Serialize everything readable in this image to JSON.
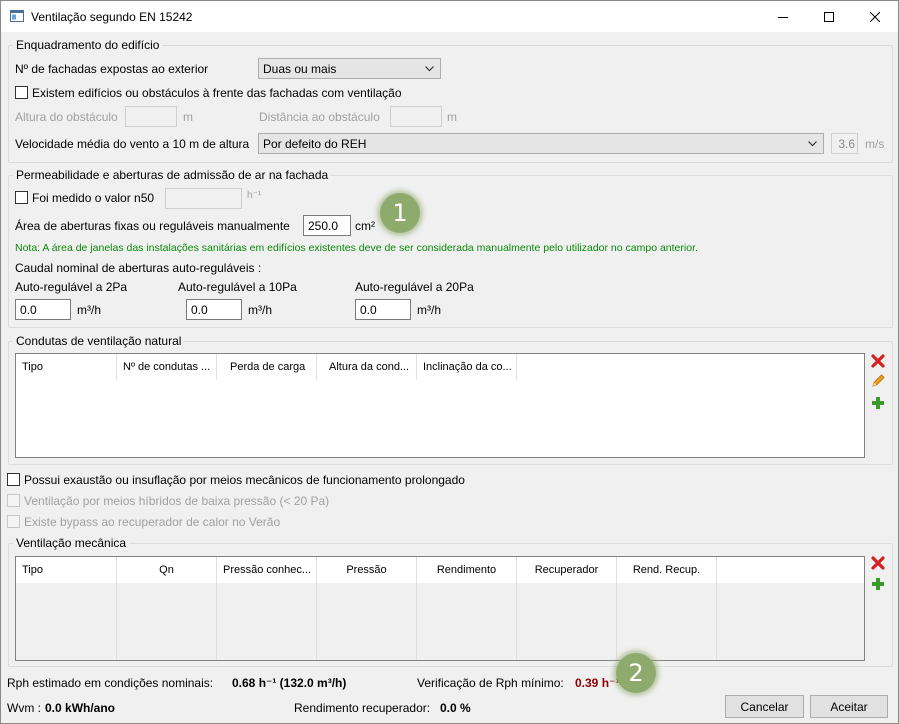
{
  "window": {
    "title": "Ventilação segundo EN 15242"
  },
  "building_group": {
    "title": "Enquadramento do edifício",
    "facades_label": "Nº de fachadas expostas ao exterior",
    "facades_value": "Duas ou mais",
    "obstacles_label": "Existem edifícios ou obstáculos à frente das fachadas com ventilação",
    "obstacle_height_label": "Altura do obstáculo",
    "obstacle_height_unit": "m",
    "obstacle_distance_label": "Distância ao obstáculo",
    "obstacle_distance_unit": "m",
    "wind_label": "Velocidade média do vento a 10 m de altura",
    "wind_value": "Por defeito do REH",
    "wind_speed_value": "3.6",
    "wind_speed_unit": "m/s"
  },
  "permeability_group": {
    "title": "Permeabilidade e aberturas de admissão de ar na fachada",
    "n50_label": "Foi medido o valor n50",
    "n50_unit": "h⁻¹",
    "area_label": "Área de aberturas fixas ou reguláveis manualmente",
    "area_value": "250.0",
    "area_unit": "cm²",
    "badge_1": "1",
    "note": "Nota: A área de janelas das instalações sanitárias em edifícios existentes deve de ser considerada manualmente pelo utilizador no campo anterior.",
    "flow_label": "Caudal nominal de aberturas auto-reguláveis :",
    "auto_2pa_label": "Auto-regulável a 2Pa",
    "auto_2pa_value": "0.0",
    "auto_10pa_label": "Auto-regulável a 10Pa",
    "auto_10pa_value": "0.0",
    "auto_20pa_label": "Auto-regulável a 20Pa",
    "auto_20pa_value": "0.0",
    "flow_unit": "m³/h"
  },
  "natural_ducts_group": {
    "title": "Condutas de ventilação natural",
    "columns": [
      "Tipo",
      "Nº de condutas ...",
      "Perda de carga",
      "Altura da cond...",
      "Inclinação da co..."
    ]
  },
  "mechanical_options": {
    "mech_exhaust_label": "Possui exaustão ou insuflação por meios mecânicos de funcionamento prolongado",
    "hybrid_label": "Ventilação por meios híbridos de baixa pressão (< 20 Pa)",
    "bypass_label": "Existe bypass ao recuperador de calor no Verão"
  },
  "mechanical_group": {
    "title": "Ventilação mecânica",
    "columns": [
      "Tipo",
      "Qn",
      "Pressão conhec...",
      "Pressão",
      "Rendimento",
      "Recuperador",
      "Rend. Recup."
    ]
  },
  "footer": {
    "rph_label": "Rph estimado em condições nominais:",
    "rph_value": "0.68 h⁻¹ (132.0 m³/h)",
    "rph_min_label": "Verificação de Rph mínimo:",
    "rph_min_value": "0.39 h⁻¹",
    "badge_2": "2",
    "wvm_label": "Wvm :",
    "wvm_value": "0.0 kWh/ano",
    "recup_label": "Rendimento recuperador:",
    "recup_value": "0.0 %",
    "cancel_label": "Cancelar",
    "accept_label": "Aceitar"
  },
  "colors": {
    "note_green": "#0a8a0a",
    "rph_min_red": "#8b0000",
    "badge_green": "#8faa6d",
    "delete_red": "#d62020",
    "add_green": "#3a9a2a"
  }
}
